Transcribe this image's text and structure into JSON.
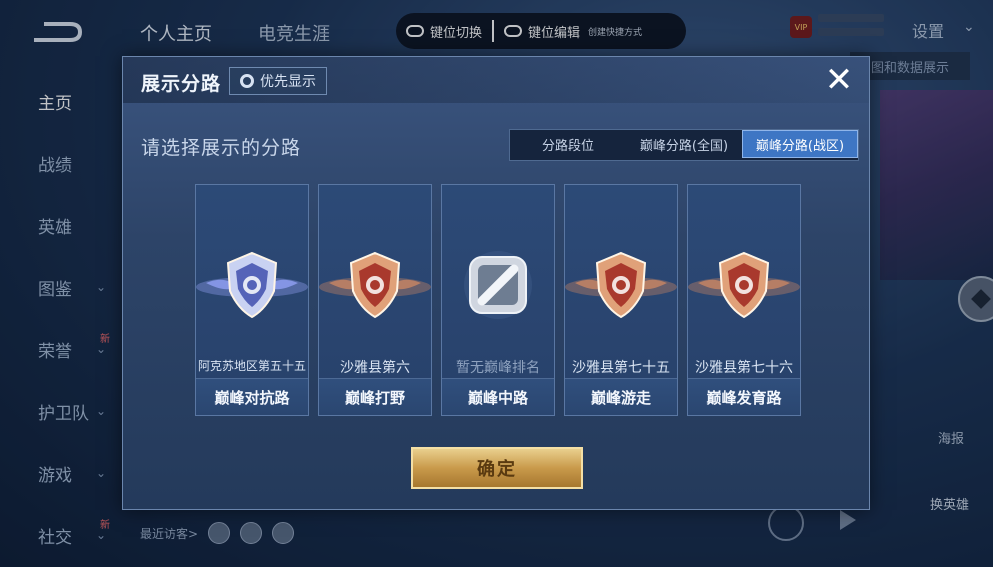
{
  "background": {
    "side_nav": [
      {
        "label": "主页",
        "active": true,
        "chevron": false,
        "new": false
      },
      {
        "label": "战绩",
        "active": false,
        "chevron": false,
        "new": false
      },
      {
        "label": "英雄",
        "active": false,
        "chevron": false,
        "new": false
      },
      {
        "label": "图鉴",
        "active": false,
        "chevron": true,
        "new": false
      },
      {
        "label": "荣誉",
        "active": false,
        "chevron": true,
        "new": true
      },
      {
        "label": "护卫队",
        "active": false,
        "chevron": true,
        "new": false
      },
      {
        "label": "游戏",
        "active": false,
        "chevron": true,
        "new": false
      },
      {
        "label": "社交",
        "active": false,
        "chevron": true,
        "new": true
      }
    ],
    "new_badge": "新",
    "top_tabs": [
      "个人主页",
      "电竞生涯"
    ],
    "settings_label": "设置",
    "vip_label": "VIP",
    "right_hint": "图和数据展示",
    "poster_label": "海报",
    "swap_hero_label": "换英雄",
    "recent_visitors_label": "最近访客>"
  },
  "key_bar": {
    "switch_label": "键位切换",
    "edit_label": "键位编辑",
    "shortcut_label": "创建快捷方式"
  },
  "modal": {
    "title": "展示分路",
    "priority_label": "优先显示",
    "close_label": "✕",
    "subtitle": "请选择展示的分路",
    "segments": [
      "分路段位",
      "巅峰分路(全国)",
      "巅峰分路(战区)"
    ],
    "selected_segment": "巅峰分路(战区)",
    "cards": [
      {
        "rank": "阿克苏地区第五十五",
        "lane": "巅峰对抗路",
        "emblem": "silver-shield-emblem"
      },
      {
        "rank": "沙雅县第六",
        "lane": "巅峰打野",
        "emblem": "bronze-shield-emblem"
      },
      {
        "rank": "暂无巅峰排名",
        "lane": "巅峰中路",
        "emblem": "grey-empty-emblem"
      },
      {
        "rank": "沙雅县第七十五",
        "lane": "巅峰游走",
        "emblem": "bronze-shield-emblem"
      },
      {
        "rank": "沙雅县第七十六",
        "lane": "巅峰发育路",
        "emblem": "bronze-shield-emblem"
      }
    ],
    "confirm_label": "确定"
  },
  "colors": {
    "modal_bg": "#2d4468",
    "segment_selected": "#3e76c4",
    "confirm_gold": "#c99a4b",
    "silver_emblem": "#9aa8ff",
    "bronze_emblem": "#d98b62"
  }
}
